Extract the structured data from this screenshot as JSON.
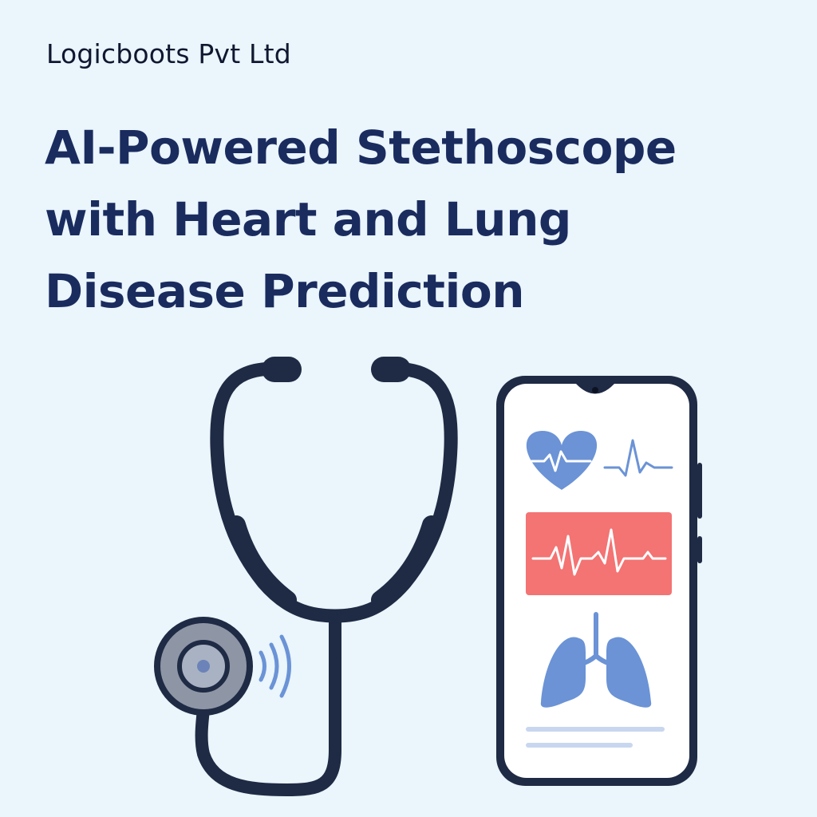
{
  "header": {
    "company": "Logicboots Pvt Ltd"
  },
  "headline": {
    "lines": [
      "AI-Powered Stethoscope",
      "with Heart and Lung",
      "Disease Prediction"
    ]
  },
  "colors": {
    "background": "#eaf5fc",
    "headline": "#1a2b5e",
    "stethoscope": "#1f2a44",
    "accent_blue": "#6b93d6",
    "alert_red": "#f47373"
  },
  "icons": [
    "stethoscope-icon",
    "sound-wave-icon",
    "smartphone-icon",
    "heart-icon",
    "pulse-wave-icon",
    "ecg-icon",
    "lungs-icon"
  ]
}
